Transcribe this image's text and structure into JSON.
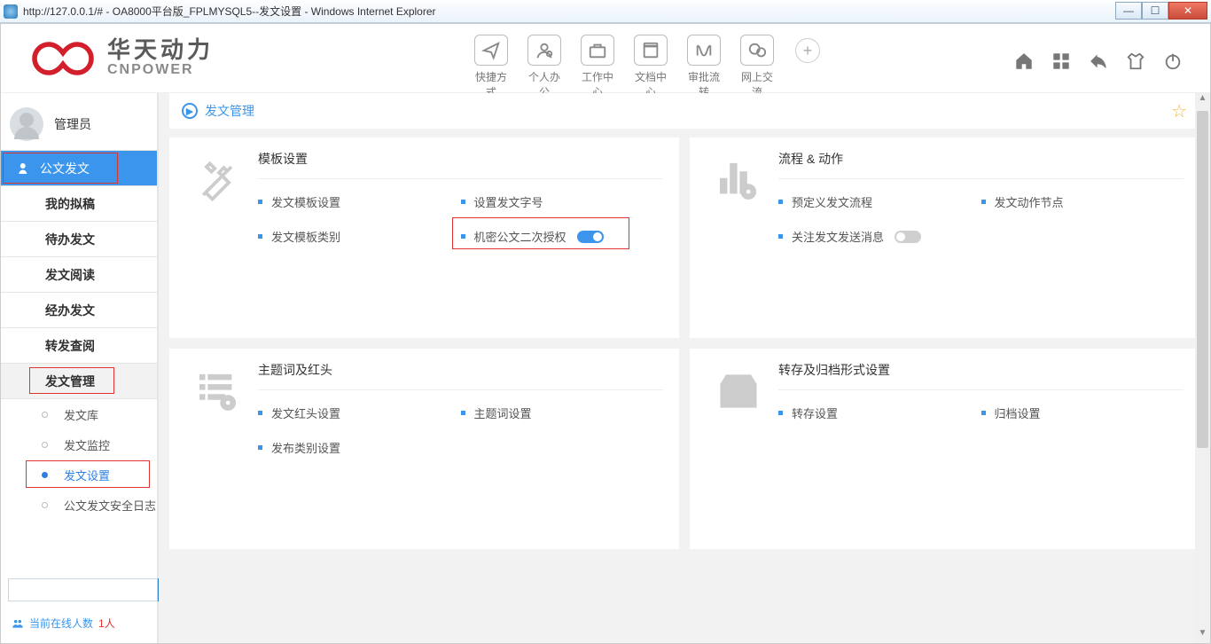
{
  "window": {
    "url": "http://127.0.0.1/#",
    "title": " - OA8000平台版_FPLMYSQL5--发文设置 - Windows Internet Explorer"
  },
  "brand": {
    "cn": "华天动力",
    "en": "CNPOWER"
  },
  "topnav": [
    {
      "label": "快捷方式"
    },
    {
      "label": "个人办公"
    },
    {
      "label": "工作中心"
    },
    {
      "label": "文档中心"
    },
    {
      "label": "审批流转"
    },
    {
      "label": "网上交流"
    }
  ],
  "user": {
    "name": "管理员"
  },
  "menu": {
    "top": "公文发文",
    "items": [
      "我的拟稿",
      "待办发文",
      "发文阅读",
      "经办发文",
      "转发查阅"
    ],
    "group": "发文管理",
    "subs": [
      "发文库",
      "发文监控",
      "发文设置",
      "公文发文安全日志"
    ]
  },
  "footer": {
    "online_label": "当前在线人数 ",
    "online_count": "1人"
  },
  "crumb": {
    "title": "发文管理"
  },
  "cards": {
    "tpl": {
      "title": "模板设置",
      "l1": "发文模板设置",
      "l2": "设置发文字号",
      "l3": "发文模板类别",
      "l4": "机密公文二次授权"
    },
    "flow": {
      "title": "流程 & 动作",
      "l1": "预定义发文流程",
      "l2": "发文动作节点",
      "l3": "关注发文发送消息"
    },
    "theme": {
      "title": "主题词及红头",
      "l1": "发文红头设置",
      "l2": "主题词设置",
      "l3": "发布类别设置"
    },
    "archive": {
      "title": "转存及归档形式设置",
      "l1": "转存设置",
      "l2": "归档设置"
    }
  }
}
